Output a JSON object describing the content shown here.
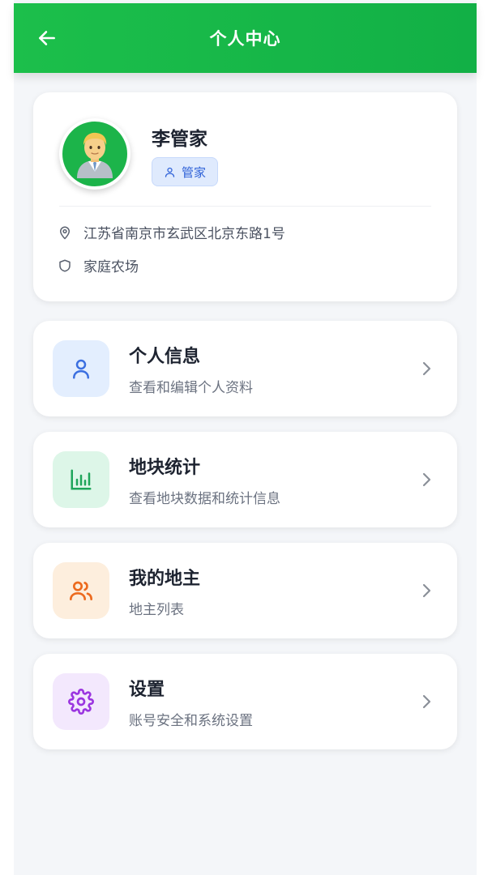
{
  "header": {
    "title": "个人中心",
    "back_icon": "arrow-left-icon"
  },
  "profile": {
    "name": "李管家",
    "role": "管家",
    "avatar_icon": "person-office-worker-avatar",
    "address": "江苏省南京市玄武区北京东路1号",
    "farm": "家庭农场"
  },
  "menu": [
    {
      "title": "个人信息",
      "subtitle": "查看和编辑个人资料",
      "icon": "user-icon",
      "icon_bg": "#e3eefe",
      "icon_color": "#3b6fe0"
    },
    {
      "title": "地块统计",
      "subtitle": "查看地块数据和统计信息",
      "icon": "bar-chart-icon",
      "icon_bg": "#ddf6e8",
      "icon_color": "#1ea55a"
    },
    {
      "title": "我的地主",
      "subtitle": "地主列表",
      "icon": "users-icon",
      "icon_bg": "#fdeedd",
      "icon_color": "#ec6a1e"
    },
    {
      "title": "设置",
      "subtitle": "账号安全和系统设置",
      "icon": "gear-icon",
      "icon_bg": "#f3e8fd",
      "icon_color": "#9b35e0"
    }
  ],
  "colors": {
    "header_green": "#1cbf4b",
    "background": "#f4f6f9",
    "role_badge_bg": "#dfeafd",
    "role_badge_text": "#2f62d8"
  }
}
